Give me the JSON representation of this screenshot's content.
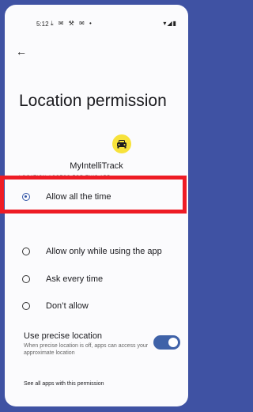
{
  "status_bar": {
    "time": "5:12",
    "left_icons": "⤓ ✉ ⚒ ✉ •",
    "right_icons": "▾◢▮"
  },
  "nav": {
    "back_icon": "arrow-left-icon",
    "back_glyph": "←"
  },
  "page": {
    "title": "Location permission",
    "app_name": "MyIntelliTrack",
    "app_icon_color": "#f7e23b",
    "section_header": "LOCATION ACCESS FOR THIS APP"
  },
  "options": [
    {
      "label": "Allow all the time",
      "selected": true
    },
    {
      "label": "Allow only while using the app",
      "selected": false
    },
    {
      "label": "Ask every time",
      "selected": false
    },
    {
      "label": "Don’t allow",
      "selected": false
    }
  ],
  "precise": {
    "title": "Use precise location",
    "description": "When precise location is off, apps can access your approximate location",
    "enabled": true
  },
  "footer": {
    "see_all": "See all apps with this permission"
  },
  "colors": {
    "frame": "#3f52a3",
    "accent": "#3457a8",
    "highlight": "#ee1c25",
    "toggle_on": "#3f62a8"
  }
}
